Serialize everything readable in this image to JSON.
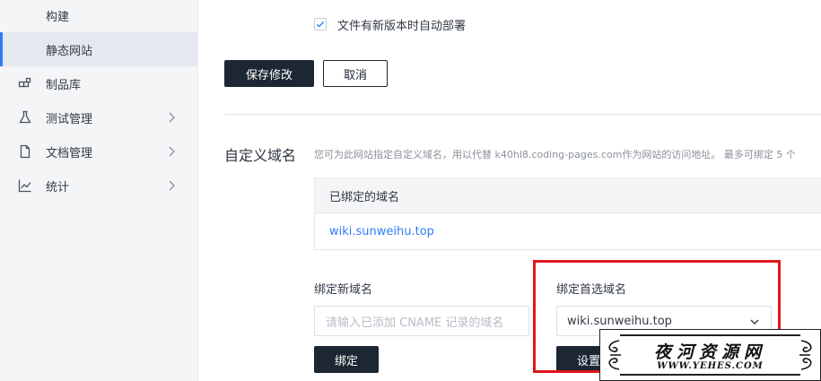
{
  "sidebar": {
    "items": [
      {
        "label": "构建",
        "icon": "",
        "chevron": false,
        "active": false
      },
      {
        "label": "静态网站",
        "icon": "",
        "chevron": false,
        "active": true
      },
      {
        "label": "制品库",
        "icon": "artifact-icon",
        "chevron": false,
        "active": false
      },
      {
        "label": "测试管理",
        "icon": "flask-icon",
        "chevron": true,
        "active": false
      },
      {
        "label": "文档管理",
        "icon": "document-icon",
        "chevron": true,
        "active": false
      },
      {
        "label": "统计",
        "icon": "chart-icon",
        "chevron": true,
        "active": false
      }
    ]
  },
  "deploy": {
    "auto_deploy_label": "文件有新版本时自动部署",
    "auto_deploy_checked": true
  },
  "actions": {
    "save_label": "保存修改",
    "cancel_label": "取消"
  },
  "custom_domain": {
    "title": "自定义域名",
    "description": "您可为此网站指定自定义域名，用以代替 k40hl8.coding-pages.com作为网站的访问地址。 最多可绑定 5 个",
    "table_header": "已绑定的域名",
    "bound_domains": [
      "wiki.sunweihu.top"
    ],
    "new_domain_label": "绑定新域名",
    "new_domain_placeholder": "请输入已添加 CNAME 记录的域名",
    "bind_button": "绑定",
    "preferred_label": "绑定首选域名",
    "preferred_value": "wiki.sunweihu.top",
    "set_button": "设置"
  },
  "watermark": {
    "title": "夜河资源网",
    "url": "WWW.YEHES.COM"
  },
  "colors": {
    "accent": "#2e7cf6",
    "dark_button": "#1d2633",
    "highlight": "#e0161b"
  }
}
